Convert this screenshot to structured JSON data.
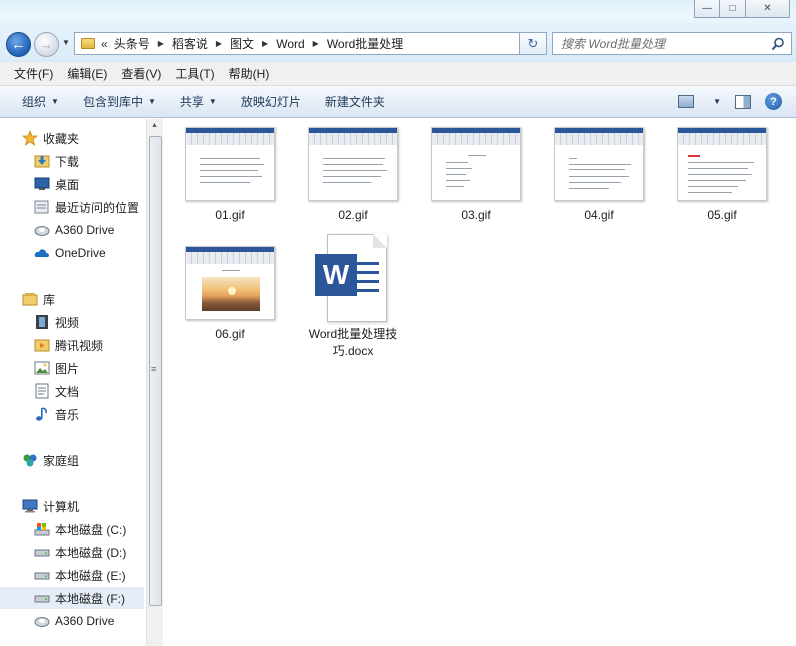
{
  "window": {
    "minimize_glyph": "—",
    "maximize_glyph": "□",
    "close_glyph": "✕"
  },
  "nav": {
    "back_glyph": "←",
    "forward_glyph": "→",
    "recent_glyph": "▼"
  },
  "address": {
    "lead_glyph": "«",
    "crumbs": [
      "头条号",
      "稻客说",
      "图文",
      "Word",
      "Word批量处理"
    ],
    "sep_glyph": "▶",
    "drop_glyph": "▼",
    "refresh_glyph": "↻"
  },
  "search": {
    "placeholder": "搜索 Word批量处理"
  },
  "menubar": {
    "items": [
      "文件(F)",
      "编辑(E)",
      "查看(V)",
      "工具(T)",
      "帮助(H)"
    ]
  },
  "commandbar": {
    "organize": "组织",
    "include_in_library": "包含到库中",
    "share": "共享",
    "slideshow": "放映幻灯片",
    "new_folder": "新建文件夹",
    "caret_glyph": "▼",
    "help_glyph": "?"
  },
  "navpane": {
    "favorites": {
      "label": "收藏夹",
      "items": [
        "下载",
        "桌面",
        "最近访问的位置",
        "A360 Drive",
        "OneDrive"
      ]
    },
    "libraries": {
      "label": "库",
      "items": [
        "视频",
        "腾讯视频",
        "图片",
        "文档",
        "音乐"
      ]
    },
    "homegroup": {
      "label": "家庭组"
    },
    "computer": {
      "label": "计算机",
      "items": [
        "本地磁盘 (C:)",
        "本地磁盘 (D:)",
        "本地磁盘 (E:)",
        "本地磁盘 (F:)",
        "A360 Drive"
      ]
    },
    "scroll_grip": "≡",
    "scroll_up": "▲"
  },
  "files": [
    {
      "name": "01.gif",
      "kind": "gif"
    },
    {
      "name": "02.gif",
      "kind": "gif"
    },
    {
      "name": "03.gif",
      "kind": "gif"
    },
    {
      "name": "04.gif",
      "kind": "gif"
    },
    {
      "name": "05.gif",
      "kind": "gif"
    },
    {
      "name": "06.gif",
      "kind": "gif-photo"
    },
    {
      "name": "Word批量处理技巧.docx",
      "kind": "docx",
      "icon_letter": "W"
    }
  ],
  "colors": {
    "word_blue": "#2b579a",
    "selection": "#e5eef8",
    "command_text": "#1e3956"
  }
}
